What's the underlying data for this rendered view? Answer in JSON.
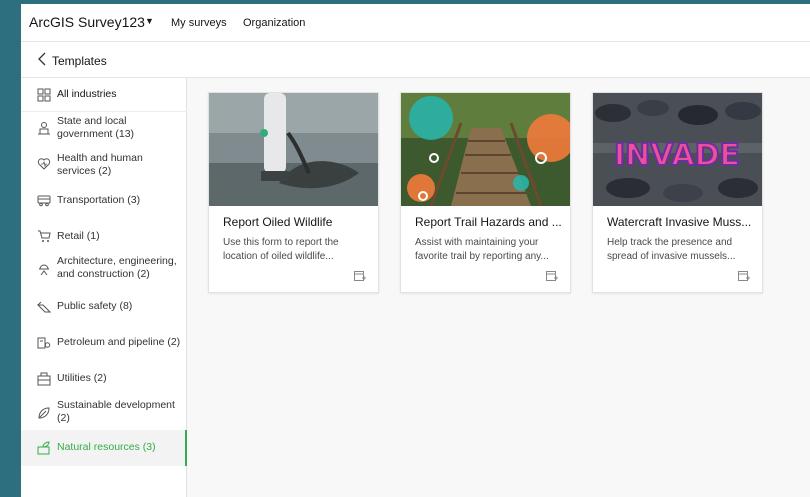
{
  "app": {
    "title": "ArcGIS Survey123",
    "nav": [
      "My surveys",
      "Organization"
    ]
  },
  "subheader": {
    "title": "Templates"
  },
  "sidebar": {
    "items": [
      {
        "label": "All industries",
        "icon": "grid-icon"
      },
      {
        "label": "State and local government (13)",
        "icon": "government-icon"
      },
      {
        "label": "Health and human services (2)",
        "icon": "health-icon"
      },
      {
        "label": "Transportation (3)",
        "icon": "bus-icon"
      },
      {
        "label": "Retail (1)",
        "icon": "cart-icon"
      },
      {
        "label": "Architecture, engineering, and construction (2)",
        "icon": "construction-icon"
      },
      {
        "label": "Public safety (8)",
        "icon": "safety-icon"
      },
      {
        "label": "Petroleum and pipeline (2)",
        "icon": "pipeline-icon"
      },
      {
        "label": "Utilities (2)",
        "icon": "utilities-icon"
      },
      {
        "label": "Sustainable development (2)",
        "icon": "sustainable-icon"
      },
      {
        "label": "Natural resources (3)",
        "icon": "natural-resources-icon"
      }
    ],
    "active_index": 10
  },
  "cards": [
    {
      "title": "Report Oiled Wildlife",
      "description": "Use this form to report the location of oiled wildlife..."
    },
    {
      "title": "Report Trail Hazards and ...",
      "description": "Assist with maintaining your favorite trail by reporting any..."
    },
    {
      "title": "Watercraft Invasive Muss...",
      "description": "Help track the presence and spread of invasive mussels..."
    }
  ],
  "card3_image_text": "INVADE",
  "colors": {
    "accent": "#35ac46",
    "background": "#2e6f7f"
  }
}
